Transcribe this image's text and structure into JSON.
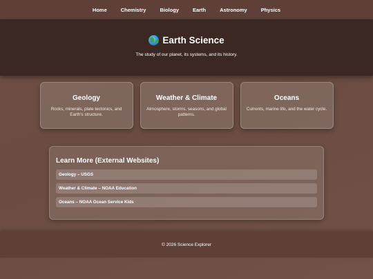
{
  "nav": {
    "items": [
      "Home",
      "Chemistry",
      "Biology",
      "Earth",
      "Astronomy",
      "Physics"
    ]
  },
  "hero": {
    "icon": "globe-icon",
    "title": "Earth Science",
    "subtitle": "The study of our planet, its systems, and its history."
  },
  "cards": [
    {
      "title": "Geology",
      "description": "Rocks, minerals, plate tectonics, and Earth's structure."
    },
    {
      "title": "Weather & Climate",
      "description": "Atmosphere, storms, seasons, and global patterns."
    },
    {
      "title": "Oceans",
      "description": "Currents, marine life, and the water cycle."
    }
  ],
  "learn_more": {
    "heading": "Learn More (External Websites)",
    "links": [
      "Geology – USGS",
      "Weather & Climate – NOAA Education",
      "Oceans – NOAA Ocean Service Kids"
    ]
  },
  "footer": {
    "text": "© 2026 Science Explorer"
  },
  "colors": {
    "nav_bg": "#5e4038",
    "hero_bg": "#3b2823",
    "page_bg": "#6e4f45"
  }
}
